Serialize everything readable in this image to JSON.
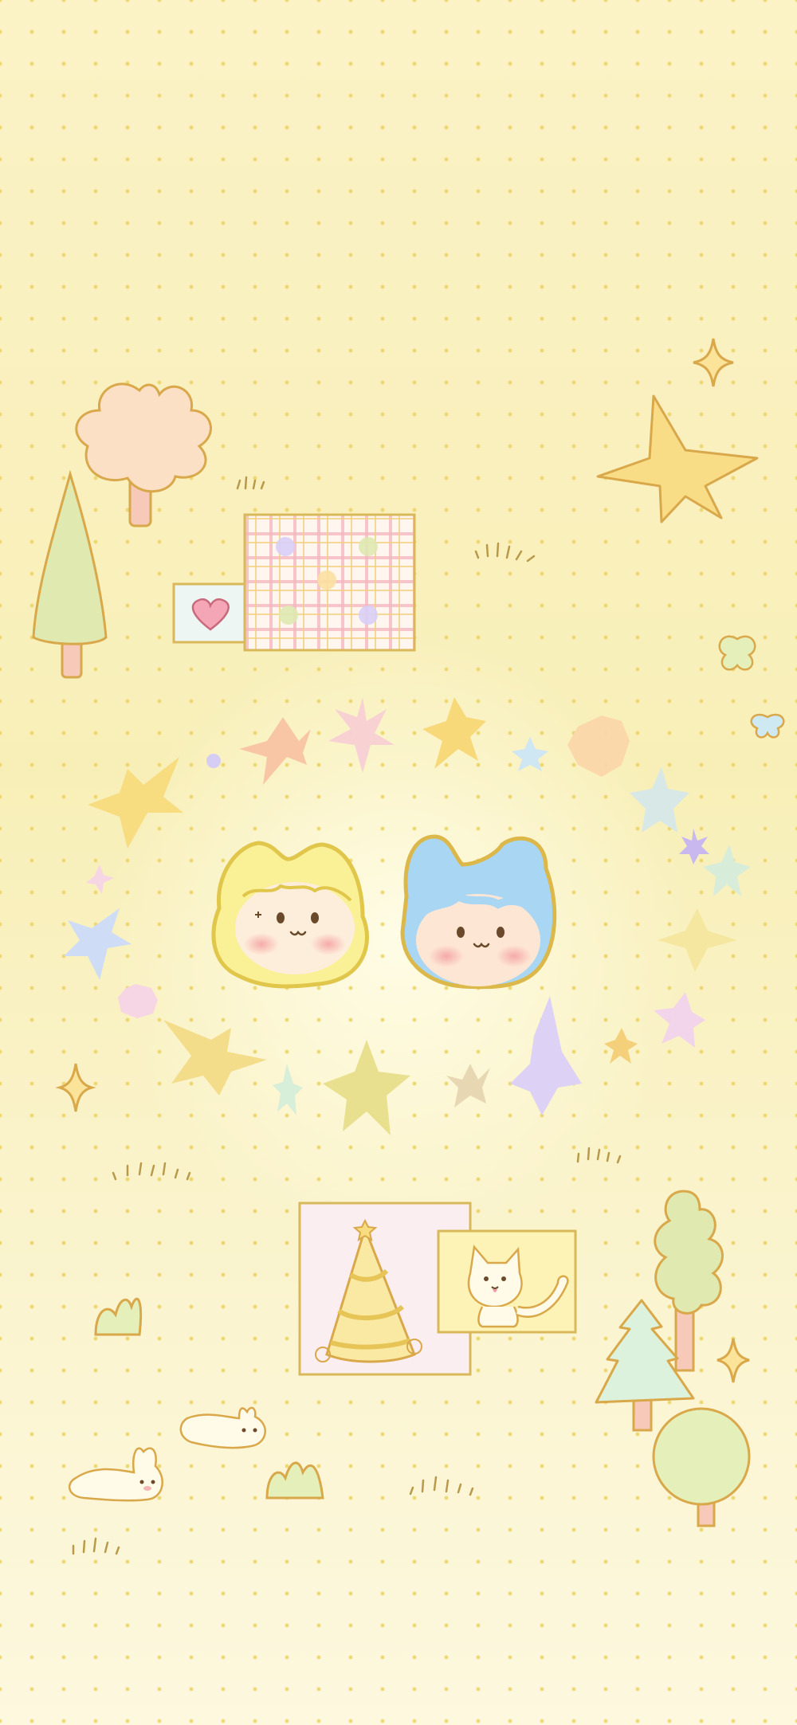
{
  "wallpaper": {
    "palette": {
      "background": "#fbf2c4",
      "dot": "#ecd466",
      "outline": "#dcb84a",
      "cream": "#fffbe8"
    },
    "elements": [
      "bush-tree-peach",
      "cone-tree-green",
      "plaid-card",
      "heart-card",
      "big-star-yellow",
      "sparkle",
      "butterfly-green",
      "butterfly-blue",
      "star-ring",
      "chick-hood-character",
      "bunny-hood-character",
      "party-hat-card",
      "cat-card",
      "tree-group",
      "bunny",
      "grass-tuft"
    ]
  }
}
